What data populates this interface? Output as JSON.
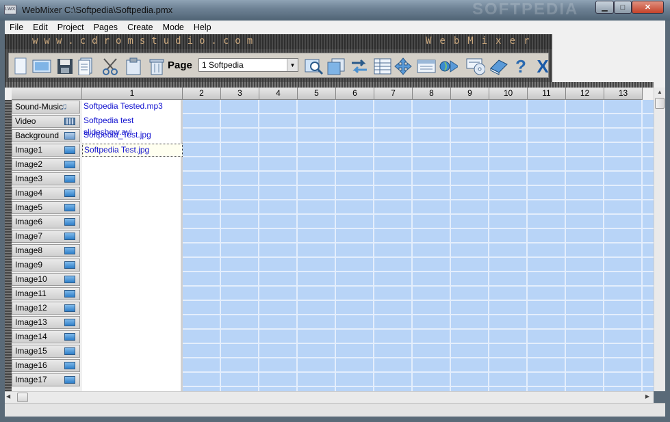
{
  "window": {
    "app_icon_text": "LWX",
    "title": "WebMixer  C:\\Softpedia\\Softpedia.pmx",
    "watermark": "SOFTPEDIA",
    "minimize": "▁",
    "maximize": "□",
    "close": "✕"
  },
  "menu": [
    "File",
    "Edit",
    "Project",
    "Pages",
    "Create",
    "Mode",
    "Help"
  ],
  "banner": {
    "url": "www.cdromstudio.com",
    "brand": "WebMixer"
  },
  "toolbar": {
    "page_label": "Page",
    "page_value": "1  Softpedia",
    "icons": [
      "new-page-icon",
      "image-icon",
      "save-icon",
      "document-icon",
      "cut-icon",
      "paste-icon",
      "trash-icon",
      "zoom-icon",
      "copy-icon",
      "swap-icon",
      "table-icon",
      "move-icon",
      "layout-icon",
      "browser-play-icon",
      "cd-export-icon",
      "book-icon",
      "help-icon",
      "exit-icon"
    ]
  },
  "grid": {
    "columns": [
      "1",
      "2",
      "3",
      "4",
      "5",
      "6",
      "7",
      "8",
      "9",
      "10",
      "11",
      "12",
      "13"
    ],
    "rows": [
      {
        "label": "Sound-Music",
        "icon": "music",
        "cell": "Softpedia Tested.mp3"
      },
      {
        "label": "Video",
        "icon": "film",
        "cell": "Softpedia test slideshow.avi"
      },
      {
        "label": "Background",
        "icon": "bg",
        "cell": "Softpedia_Test.jpg"
      },
      {
        "label": "Image1",
        "icon": "img",
        "cell": "Softpedia Test.jpg"
      },
      {
        "label": "Image2",
        "icon": "img",
        "cell": ""
      },
      {
        "label": "Image3",
        "icon": "img",
        "cell": ""
      },
      {
        "label": "Image4",
        "icon": "img",
        "cell": ""
      },
      {
        "label": "Image5",
        "icon": "img",
        "cell": ""
      },
      {
        "label": "Image6",
        "icon": "img",
        "cell": ""
      },
      {
        "label": "Image7",
        "icon": "img",
        "cell": ""
      },
      {
        "label": "Image8",
        "icon": "img",
        "cell": ""
      },
      {
        "label": "Image9",
        "icon": "img",
        "cell": ""
      },
      {
        "label": "Image10",
        "icon": "img",
        "cell": ""
      },
      {
        "label": "Image11",
        "icon": "img",
        "cell": ""
      },
      {
        "label": "Image12",
        "icon": "img",
        "cell": ""
      },
      {
        "label": "Image13",
        "icon": "img",
        "cell": ""
      },
      {
        "label": "Image14",
        "icon": "img",
        "cell": ""
      },
      {
        "label": "Image15",
        "icon": "img",
        "cell": ""
      },
      {
        "label": "Image16",
        "icon": "img",
        "cell": ""
      },
      {
        "label": "Image17",
        "icon": "img",
        "cell": ""
      }
    ],
    "selected_row": 3
  },
  "colors": {
    "grid_blue": "#b8d4f7",
    "link_text": "#1515d0"
  }
}
